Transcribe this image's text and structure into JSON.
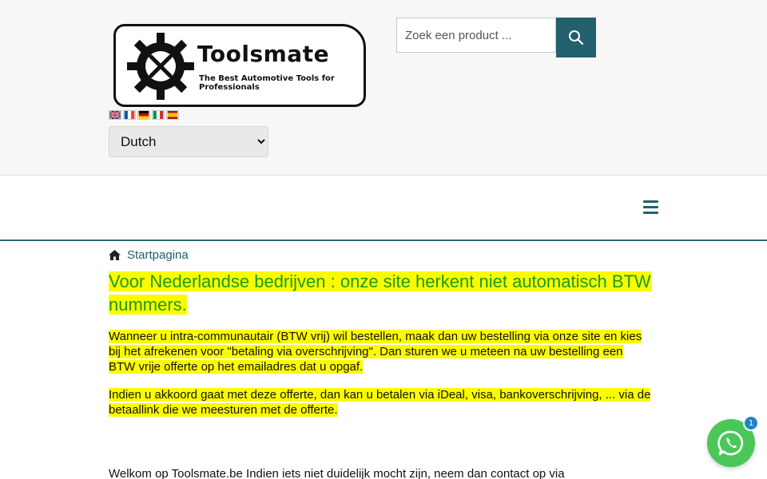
{
  "header": {
    "logo": {
      "title": "Toolsmate",
      "tagline": "The Best Automotive Tools for Professionals"
    },
    "flags": [
      {
        "icon": "uk-flag-icon",
        "colors": [
          "#012169",
          "#ffffff",
          "#c8102e"
        ]
      },
      {
        "icon": "france-flag-icon",
        "colors": [
          "#0055a4",
          "#ffffff",
          "#ef4135"
        ]
      },
      {
        "icon": "germany-flag-icon",
        "colors": [
          "#000000",
          "#dd0000",
          "#ffce00"
        ]
      },
      {
        "icon": "italy-flag-icon",
        "colors": [
          "#009246",
          "#ffffff",
          "#ce2b37"
        ]
      },
      {
        "icon": "spain-flag-icon",
        "colors": [
          "#aa151b",
          "#f1bf00",
          "#aa151b"
        ]
      }
    ],
    "language_select": {
      "selected": "Dutch"
    },
    "search": {
      "placeholder": "Zoek een product ...",
      "value": "",
      "button_icon": "search-icon"
    }
  },
  "nav": {
    "menu_icon": "hamburger-menu-icon"
  },
  "breadcrumb": {
    "home_icon": "home-icon",
    "label": "Startpagina"
  },
  "content": {
    "headline": "Voor Nederlandse bedrijven : onze site herkent niet automatisch BTW nummers.",
    "paragraph1": "Wanneer u intra-communautair (BTW vrij) wil bestellen, maak dan uw bestelling via onze site en kies bij het afrekenen voor \"betaling via overschrijving\". Dan sturen we u meteen na uw bestelling een BTW vrije offerte op het emailadres dat u opgaf.",
    "paragraph2": "Indien u akkoord gaat met deze offerte, dan kan u betalen via iDeal, visa, bankoverschrijving, ... via de betaallink die we meesturen met de offerte.",
    "welcome": "Welkom op Toolsmate.be Indien iets niet duidelijk mocht zijn, neem dan contact op via"
  },
  "whatsapp": {
    "icon": "whatsapp-icon",
    "badge": "1"
  },
  "colors": {
    "accent": "#23606d",
    "highlight": "#fbfb00",
    "headline": "#1a9a1a",
    "whatsapp": "#4bc75a",
    "badge": "#1e86c7"
  }
}
